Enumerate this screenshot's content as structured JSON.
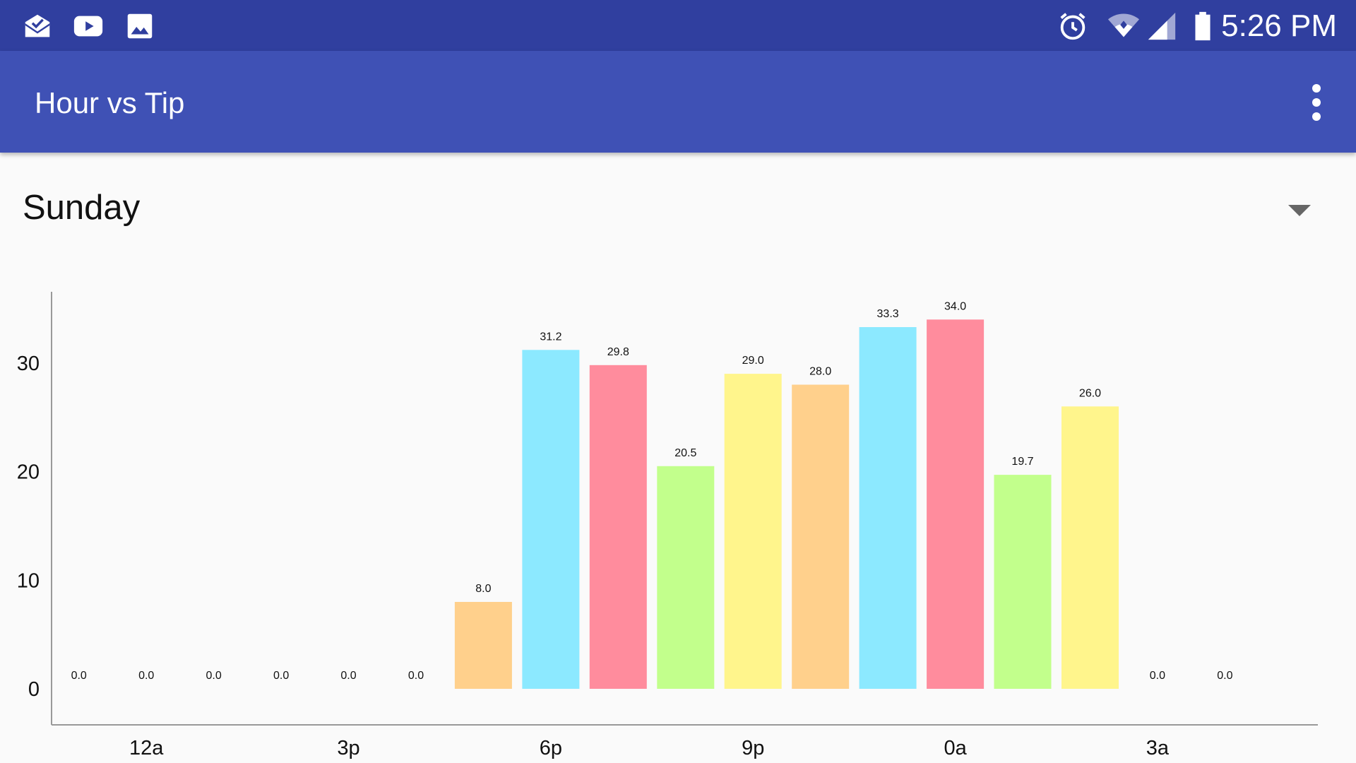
{
  "status_bar": {
    "time": "5:26 PM",
    "left_icons": [
      "mail-check-icon",
      "youtube-icon",
      "gallery-image-icon"
    ],
    "right_icons": [
      "alarm-clock-icon",
      "wifi-icon",
      "cell-signal-icon",
      "battery-icon"
    ],
    "background": "#303f9f"
  },
  "app_bar": {
    "title": "Hour vs Tip",
    "menu_icon": "overflow-menu-icon",
    "background": "#3f51b5"
  },
  "selector": {
    "selected": "Sunday",
    "icon": "dropdown-arrow-icon"
  },
  "chart_data": {
    "type": "bar",
    "categories": [
      "",
      "12a",
      "",
      "",
      "3p",
      "",
      "",
      "6p",
      "",
      "",
      "9p",
      "",
      "",
      "0a",
      "",
      "",
      "3a",
      ""
    ],
    "values": [
      0.0,
      0.0,
      0.0,
      0.0,
      0.0,
      0.0,
      8.0,
      31.2,
      29.8,
      20.5,
      29.0,
      28.0,
      33.3,
      34.0,
      19.7,
      26.0,
      0.0,
      0.0
    ],
    "data_labels": [
      "0.0",
      "0.0",
      "0.0",
      "0.0",
      "0.0",
      "0.0",
      "8.0",
      "31.2",
      "29.8",
      "20.5",
      "29.0",
      "28.0",
      "33.3",
      "34.0",
      "19.7",
      "26.0",
      "0.0",
      "0.0"
    ],
    "yticks": [
      0,
      10,
      20,
      30
    ],
    "ylim": [
      0,
      37.4
    ],
    "title": "",
    "xlabel": "",
    "ylabel": "",
    "grid": false,
    "legend": "none",
    "colors": [
      "#fff58c",
      "#ffd08c",
      "#8ce9ff",
      "#ff8c9d",
      "#c2ff8c"
    ]
  }
}
